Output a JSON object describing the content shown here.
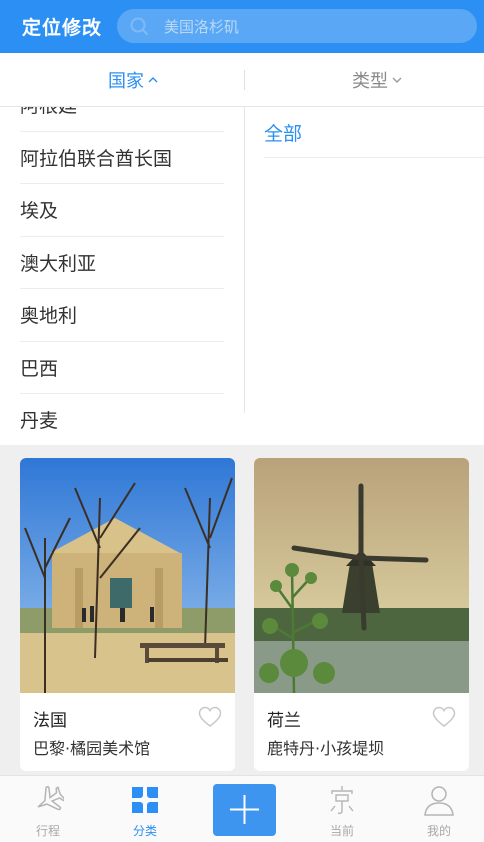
{
  "header": {
    "title": "定位修改",
    "search_placeholder": "美国洛杉矶"
  },
  "filters": {
    "country_label": "国家",
    "type_label": "类型"
  },
  "country_list": [
    "阿根廷",
    "阿拉伯联合酋长国",
    "埃及",
    "澳大利亚",
    "奥地利",
    "巴西",
    "丹麦"
  ],
  "type_list": [
    "全部"
  ],
  "cards": [
    {
      "title": "法国",
      "subtitle": "巴黎·橘园美术馆",
      "favorite_icon": "heart-outline-icon"
    },
    {
      "title": "荷兰",
      "subtitle": "鹿特丹·小孩堤坝",
      "favorite_icon": "heart-outline-icon"
    }
  ],
  "tabbar": {
    "items": [
      {
        "label": "行程",
        "icon": "airplane-icon",
        "active": false
      },
      {
        "label": "分类",
        "icon": "grid-icon",
        "active": true
      },
      {
        "label": "当前",
        "icon": "location-icon",
        "active": false
      },
      {
        "label": "我的",
        "icon": "user-icon",
        "active": false
      }
    ],
    "add_icon": "plus-icon"
  },
  "colors": {
    "primary": "#2b8ff3",
    "text_inactive": "#a8a8a8",
    "background_gray": "#efefef"
  }
}
